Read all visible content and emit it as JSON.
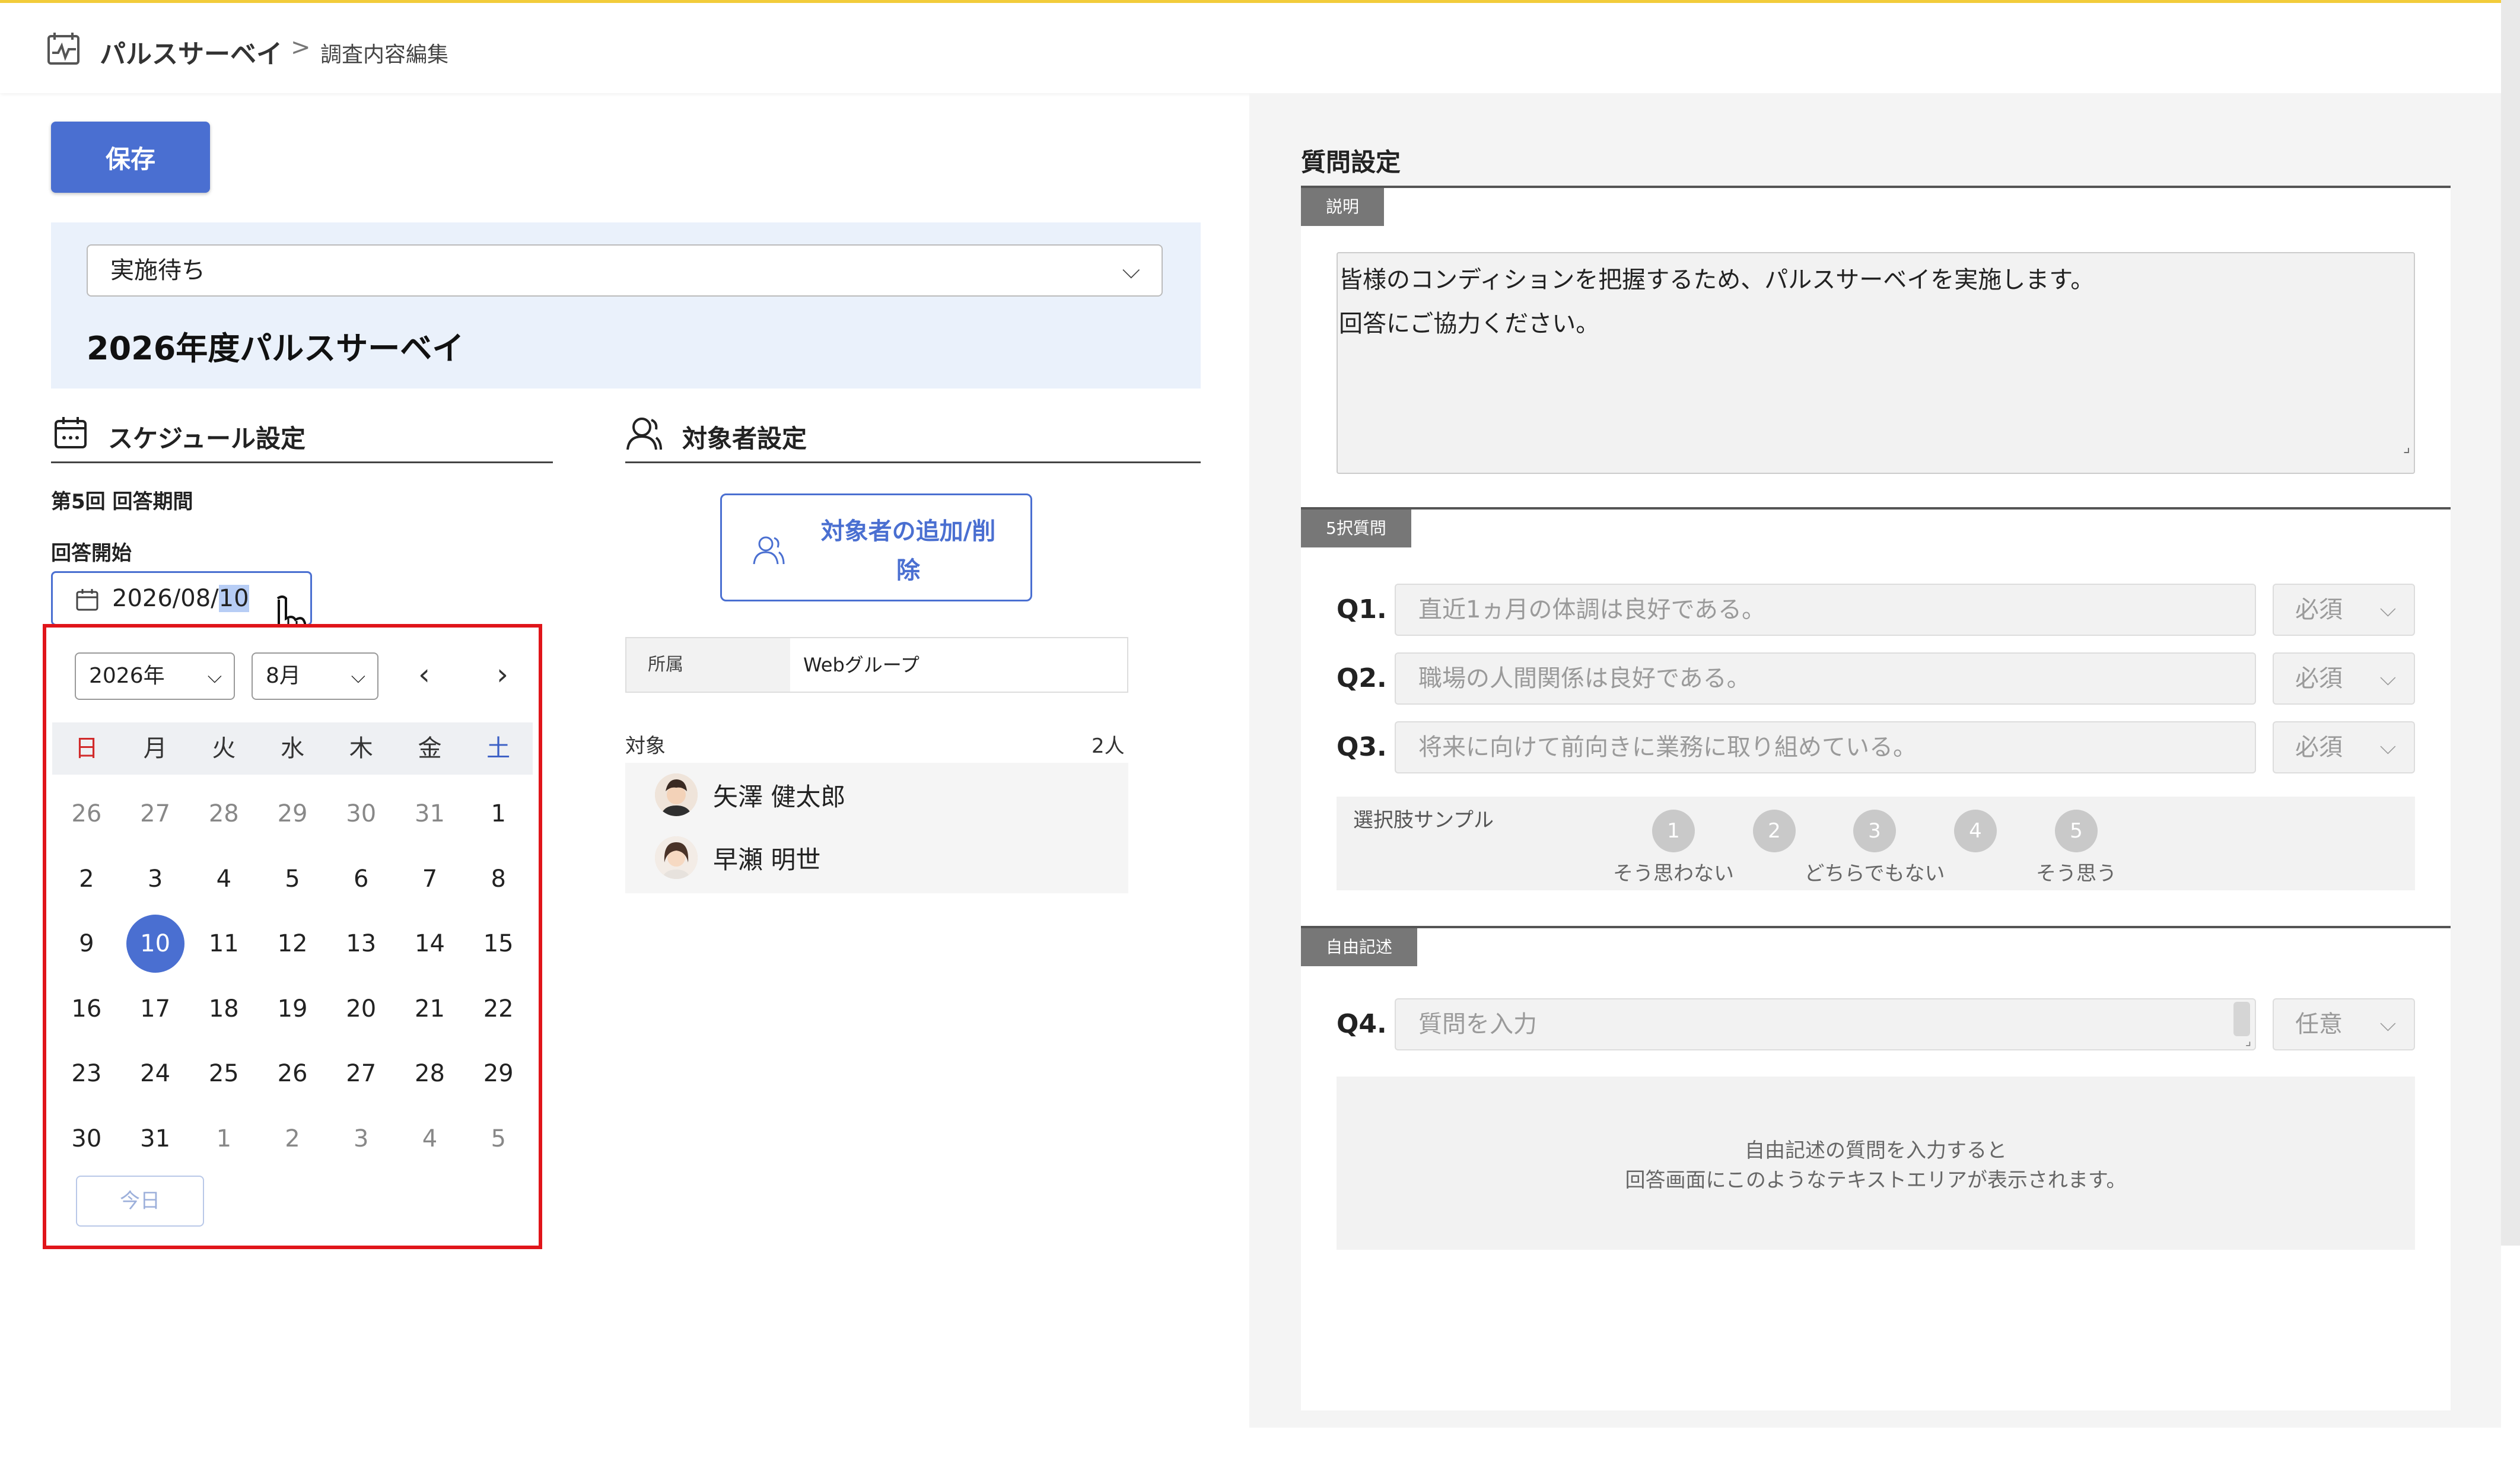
{
  "header": {
    "app_name": "パルスサーベイ",
    "separator": ">",
    "breadcrumb": "調査内容編集",
    "accent_color": "#f2cc3a"
  },
  "toolbar": {
    "save_label": "保存"
  },
  "survey": {
    "status": "実施待ち",
    "title": "2026年度パルスサーベイ"
  },
  "schedule": {
    "section_title": "スケジュール設定",
    "round_label": "第5回 回答期間",
    "start_label": "回答開始",
    "start_value_prefix": "2026/08/",
    "start_value_selected": "10"
  },
  "calendar": {
    "year": "2026年",
    "month": "8月",
    "weekdays": [
      "日",
      "月",
      "火",
      "水",
      "木",
      "金",
      "土"
    ],
    "weeks": [
      [
        "26",
        "27",
        "28",
        "29",
        "30",
        "31",
        "1"
      ],
      [
        "2",
        "3",
        "4",
        "5",
        "6",
        "7",
        "8"
      ],
      [
        "9",
        "10",
        "11",
        "12",
        "13",
        "14",
        "15"
      ],
      [
        "16",
        "17",
        "18",
        "19",
        "20",
        "21",
        "22"
      ],
      [
        "23",
        "24",
        "25",
        "26",
        "27",
        "28",
        "29"
      ],
      [
        "30",
        "31",
        "1",
        "2",
        "3",
        "4",
        "5"
      ]
    ],
    "selected_day": "10",
    "today_label": "今日",
    "selected_color": "#4a6fd1"
  },
  "targets": {
    "section_title": "対象者設定",
    "add_button_label_line1": "対象者の追加/削",
    "add_button_label_line2": "除",
    "dept_key": "所属",
    "dept_value": "Webグループ",
    "list_label": "対象",
    "count": "2人",
    "people": [
      "矢澤 健太郎",
      "早瀬 明世"
    ]
  },
  "questions": {
    "section_title": "質問設定",
    "description_tag": "説明",
    "description_line1": "皆様のコンディションを把握するため、パルスサーベイを実施します。",
    "description_line2": "回答にご協力ください。",
    "choice_tag": "5択質問",
    "items": [
      {
        "number": "Q1.",
        "text": "直近1ヵ月の体調は良好である。",
        "required": "必須"
      },
      {
        "number": "Q2.",
        "text": "職場の人間関係は良好である。",
        "required": "必須"
      },
      {
        "number": "Q3.",
        "text": "将来に向けて前向きに業務に取り組めている。",
        "required": "必須"
      }
    ],
    "sample_label": "選択肢サンプル",
    "options": [
      "1",
      "2",
      "3",
      "4",
      "5"
    ],
    "option_labels": [
      "そう思わない",
      "どちらでもない",
      "そう思う"
    ],
    "free_tag": "自由記述",
    "q4": {
      "number": "Q4.",
      "placeholder": "質問を入力",
      "required": "任意"
    },
    "free_note_line1": "自由記述の質問を入力すると",
    "free_note_line2": "回答画面にこのようなテキストエリアが表示されます。"
  }
}
